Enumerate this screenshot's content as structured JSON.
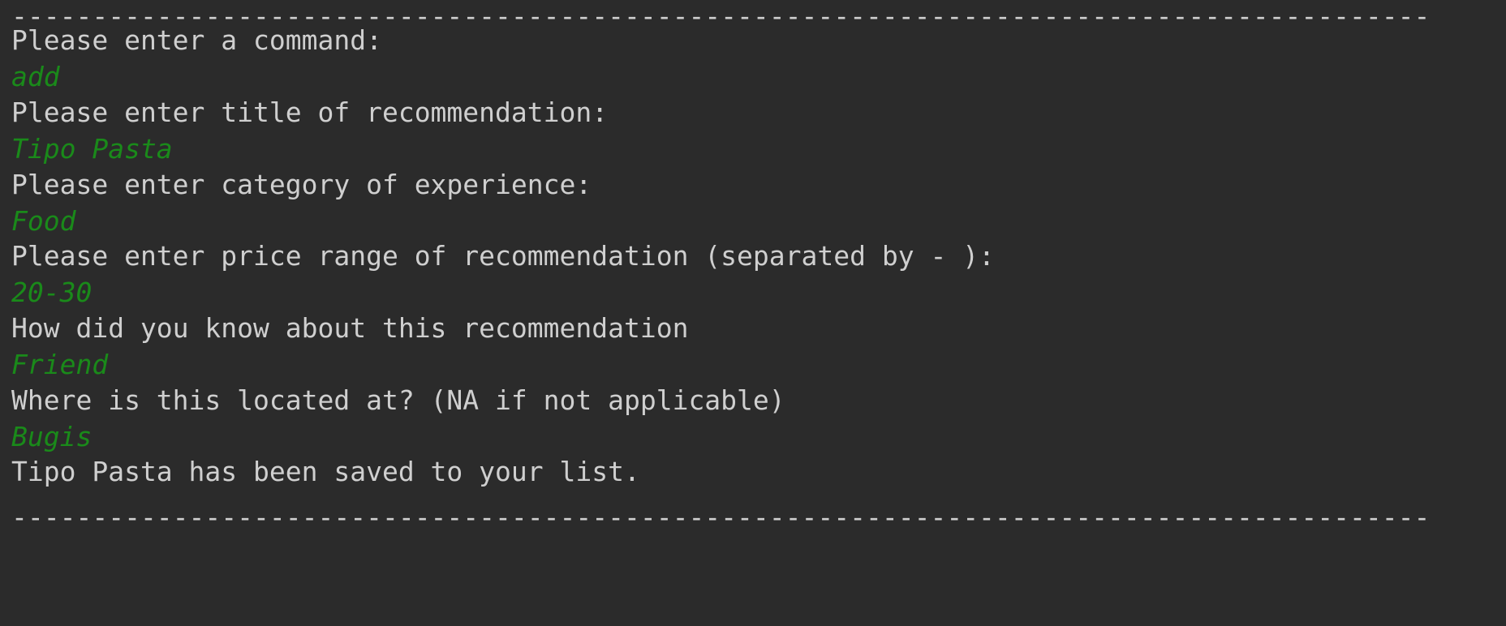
{
  "console": {
    "divider_top": "----------------------------------------------------------------------------------------",
    "lines": [
      {
        "kind": "output",
        "text": "Please enter a command:"
      },
      {
        "kind": "input",
        "text": "add"
      },
      {
        "kind": "output",
        "text": "Please enter title of recommendation:"
      },
      {
        "kind": "input",
        "text": "Tipo Pasta"
      },
      {
        "kind": "output",
        "text": "Please enter category of experience:"
      },
      {
        "kind": "input",
        "text": "Food"
      },
      {
        "kind": "output",
        "text": "Please enter price range of recommendation (separated by - ):"
      },
      {
        "kind": "input",
        "text": "20-30"
      },
      {
        "kind": "output",
        "text": "How did you know about this recommendation"
      },
      {
        "kind": "input",
        "text": "Friend"
      },
      {
        "kind": "output",
        "text": "Where is this located at? (NA if not applicable)"
      },
      {
        "kind": "input",
        "text": "Bugis"
      },
      {
        "kind": "output",
        "text": "Tipo Pasta has been saved to your list."
      }
    ],
    "divider_bottom": "----------------------------------------------------------------------------------------"
  },
  "colors": {
    "background": "#2b2b2b",
    "output_text": "#cfcfcf",
    "user_input_text": "#1a8a1a"
  }
}
